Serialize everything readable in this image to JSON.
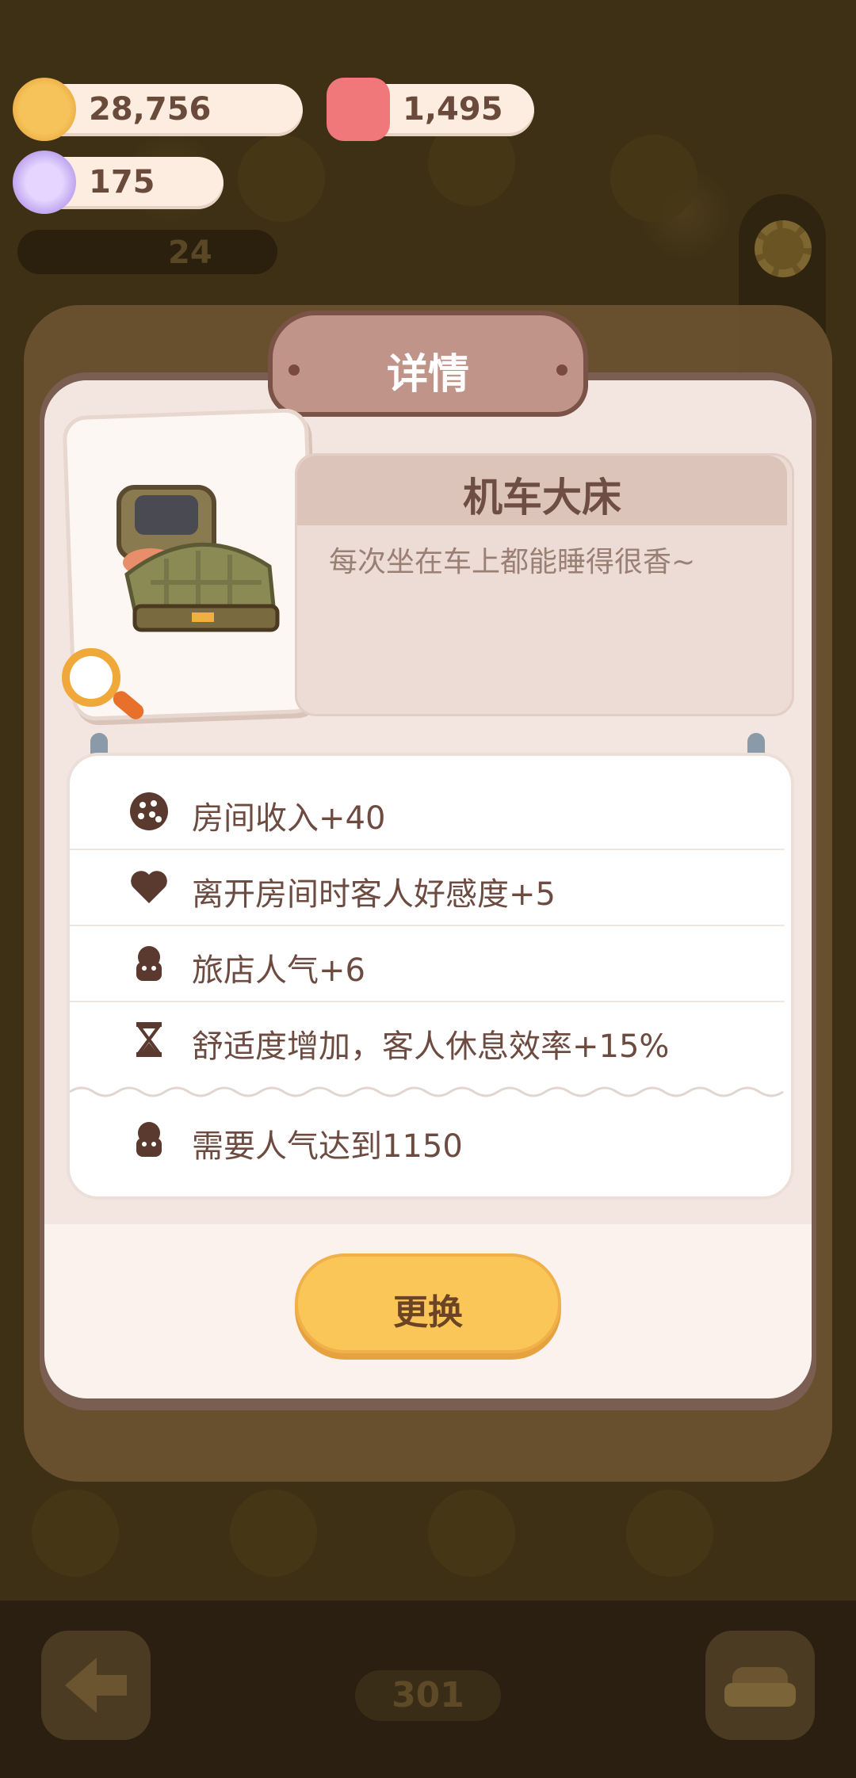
{
  "resources": {
    "cookies": "28,756",
    "candles": "1,495",
    "candy": "175",
    "visitors": "24"
  },
  "dialog": {
    "title": "详情",
    "item_name": "机车大床",
    "item_desc": "每次坐在车上都能睡得很香~",
    "stats": [
      {
        "icon": "cookie-icon",
        "text": "房间收入+40"
      },
      {
        "icon": "heart-icon",
        "text": "离开房间时客人好感度+5"
      },
      {
        "icon": "popularity-icon",
        "text": "旅店人气+6"
      },
      {
        "icon": "hourglass-icon",
        "text": "舒适度增加，客人休息效率+15%"
      }
    ],
    "requirement": "需要人气达到1150",
    "button_label": "更换"
  },
  "bottom_bar": {
    "page_number": "301"
  }
}
